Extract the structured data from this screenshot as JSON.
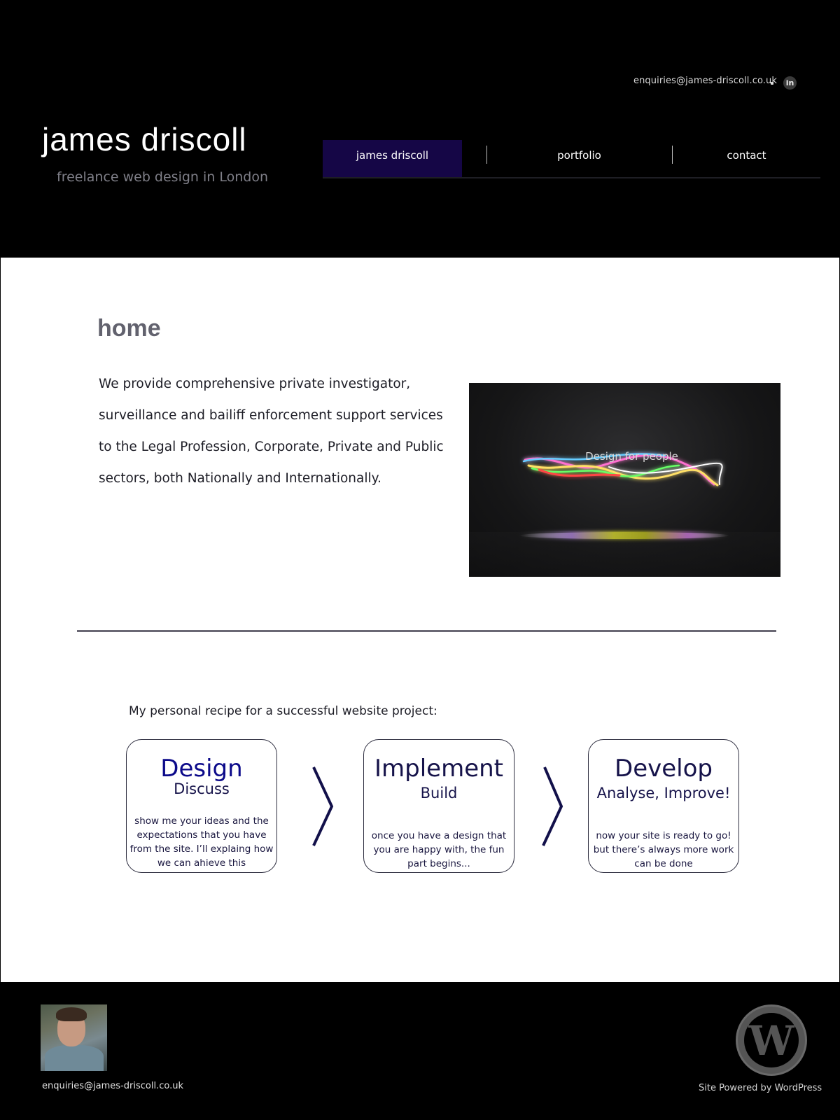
{
  "header": {
    "email": "enquiries@james-driscoll.co.uk",
    "linkedin_icon": "in",
    "title": "james driscoll",
    "tagline": "freelance web design in London"
  },
  "nav": {
    "items": [
      {
        "label": "james driscoll",
        "active": true
      },
      {
        "label": "portfolio",
        "active": false
      },
      {
        "label": "contact",
        "active": false
      }
    ]
  },
  "main": {
    "page_title": "home",
    "intro": "We provide comprehensive private investigator, surveillance and bailiff enforcement support services to the Legal Profession, Corporate, Private and Public sectors, both Nationally and Internationally.",
    "hero_caption": "Design for people",
    "recipe_title": "My personal recipe for a successful website project:",
    "steps": [
      {
        "heading": "Design",
        "sub": "Discuss",
        "desc": "show me your ideas and the expectations that you have from the site. I’ll explaing how we can ahieve this"
      },
      {
        "heading": "Implement",
        "sub": "Build",
        "desc": "once you have a design that you are happy with, the fun part begins..."
      },
      {
        "heading": "Develop",
        "sub": "Analyse, Improve!",
        "desc": "now your site is ready to go! but there’s always more work can be done"
      }
    ]
  },
  "footer": {
    "email": "enquiries@james-driscoll.co.uk",
    "wordpress_letter": "W",
    "powered": "Site Powered by WordPress"
  },
  "colors": {
    "nav_active": "#150646",
    "card_text": "#16134a",
    "design_heading": "#0c0a8a"
  }
}
